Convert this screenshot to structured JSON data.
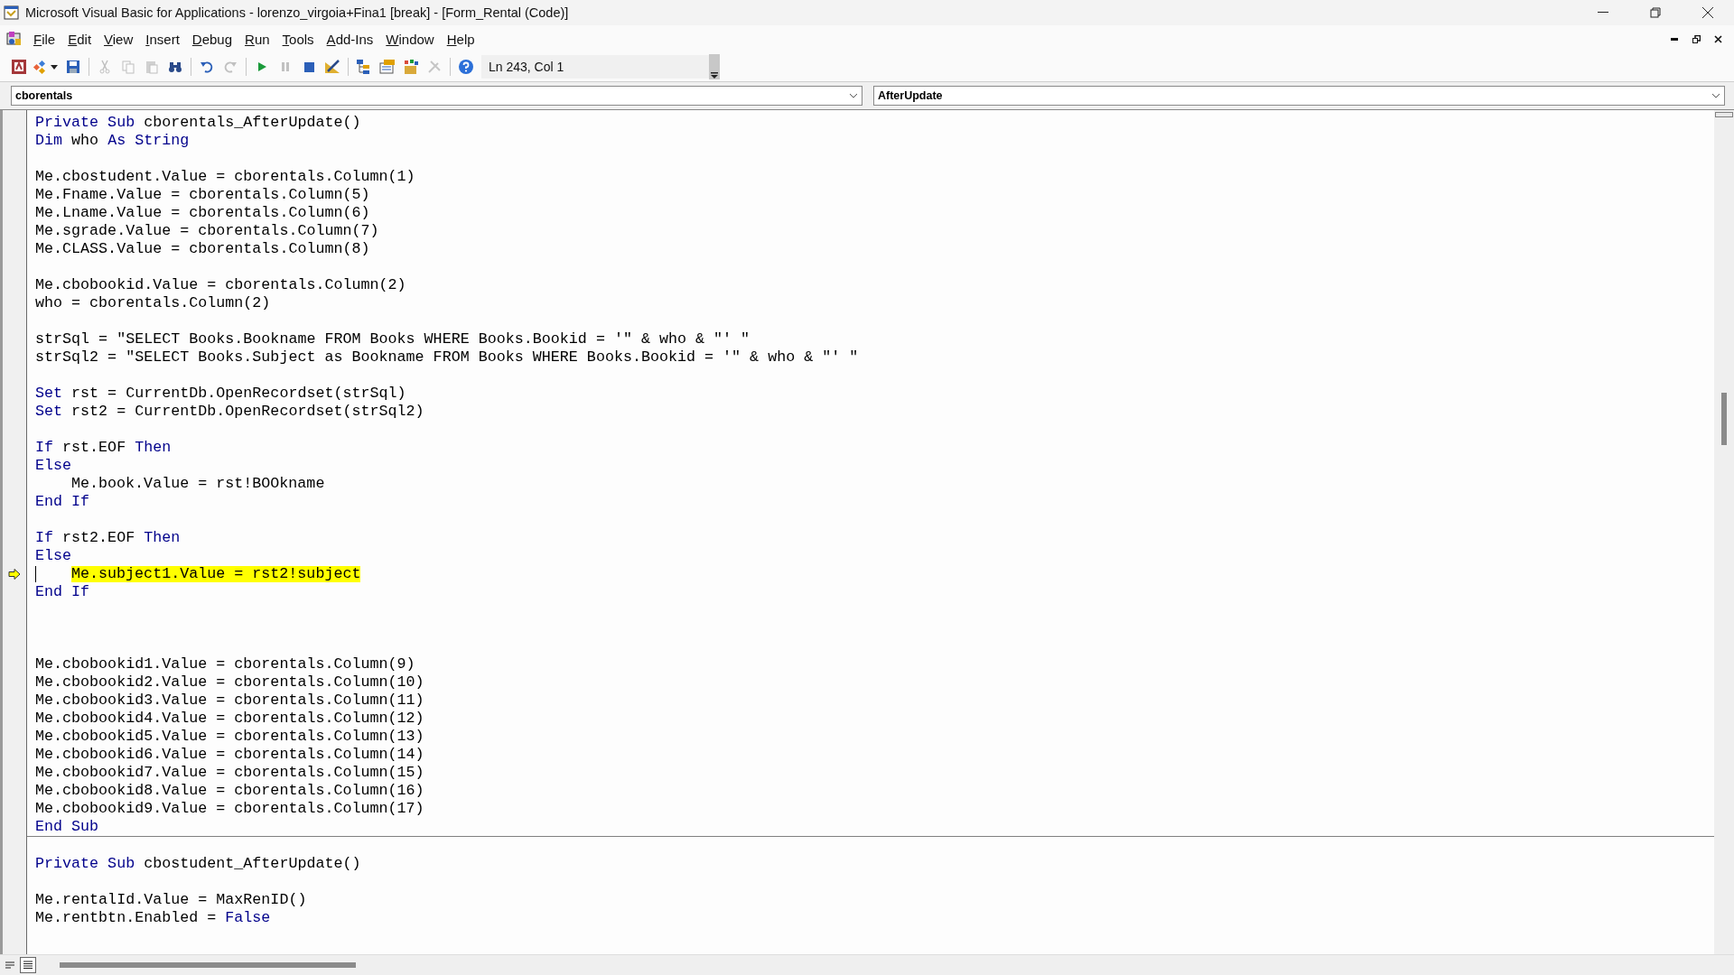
{
  "window": {
    "title": "Microsoft Visual Basic for Applications - lorenzo_virgoia+Fina1 [break] - [Form_Rental (Code)]"
  },
  "menu": [
    {
      "label": "File"
    },
    {
      "label": "Edit"
    },
    {
      "label": "View"
    },
    {
      "label": "Insert"
    },
    {
      "label": "Debug"
    },
    {
      "label": "Run"
    },
    {
      "label": "Tools"
    },
    {
      "label": "Add-Ins"
    },
    {
      "label": "Window"
    },
    {
      "label": "Help"
    }
  ],
  "toolbar": [
    {
      "kind": "access",
      "disabled": false
    },
    {
      "kind": "insert",
      "disabled": false
    },
    {
      "kind": "save",
      "disabled": false
    },
    {
      "kind": "sep"
    },
    {
      "kind": "cut",
      "disabled": true
    },
    {
      "kind": "copy",
      "disabled": true
    },
    {
      "kind": "paste",
      "disabled": true
    },
    {
      "kind": "find",
      "disabled": false
    },
    {
      "kind": "sep"
    },
    {
      "kind": "undo",
      "disabled": false
    },
    {
      "kind": "redo",
      "disabled": true
    },
    {
      "kind": "sep"
    },
    {
      "kind": "run",
      "disabled": false
    },
    {
      "kind": "pause",
      "disabled": true
    },
    {
      "kind": "reset",
      "disabled": false
    },
    {
      "kind": "design",
      "disabled": false
    },
    {
      "kind": "sep"
    },
    {
      "kind": "project",
      "disabled": false
    },
    {
      "kind": "properties",
      "disabled": false
    },
    {
      "kind": "browser",
      "disabled": false
    },
    {
      "kind": "toolbox",
      "disabled": true
    },
    {
      "kind": "sep"
    },
    {
      "kind": "help",
      "disabled": false
    }
  ],
  "cursor_position": "Ln 243, Col 1",
  "object_box": {
    "value": "cborentals"
  },
  "procedure_box": {
    "value": "AfterUpdate"
  },
  "procedures": [
    {
      "lines": [
        {
          "kind": "code",
          "segments": [
            {
              "kind": "keyword",
              "text": "Private Sub"
            },
            {
              "kind": "plain",
              "text": " cborentals_AfterUpdate()"
            }
          ]
        },
        {
          "kind": "code",
          "segments": [
            {
              "kind": "keyword",
              "text": "Dim"
            },
            {
              "kind": "plain",
              "text": " who "
            },
            {
              "kind": "keyword",
              "text": "As String"
            }
          ]
        },
        {
          "kind": "blank"
        },
        {
          "kind": "code",
          "segments": [
            {
              "kind": "plain",
              "text": "Me.cbostudent.Value = cborentals.Column(1)"
            }
          ]
        },
        {
          "kind": "code",
          "segments": [
            {
              "kind": "plain",
              "text": "Me.Fname.Value = cborentals.Column(5)"
            }
          ]
        },
        {
          "kind": "code",
          "segments": [
            {
              "kind": "plain",
              "text": "Me.Lname.Value = cborentals.Column(6)"
            }
          ]
        },
        {
          "kind": "code",
          "segments": [
            {
              "kind": "plain",
              "text": "Me.sgrade.Value = cborentals.Column(7)"
            }
          ]
        },
        {
          "kind": "code",
          "segments": [
            {
              "kind": "plain",
              "text": "Me.CLASS.Value = cborentals.Column(8)"
            }
          ]
        },
        {
          "kind": "blank"
        },
        {
          "kind": "code",
          "segments": [
            {
              "kind": "plain",
              "text": "Me.cbobookid.Value = cborentals.Column(2)"
            }
          ]
        },
        {
          "kind": "code",
          "segments": [
            {
              "kind": "plain",
              "text": "who = cborentals.Column(2)"
            }
          ]
        },
        {
          "kind": "blank"
        },
        {
          "kind": "code",
          "segments": [
            {
              "kind": "plain",
              "text": "strSql = \"SELECT Books.Bookname FROM Books WHERE Books.Bookid = '\" & who & \"' \""
            }
          ]
        },
        {
          "kind": "code",
          "segments": [
            {
              "kind": "plain",
              "text": "strSql2 = \"SELECT Books.Subject as Bookname FROM Books WHERE Books.Bookid = '\" & who & \"' \""
            }
          ]
        },
        {
          "kind": "blank"
        },
        {
          "kind": "code",
          "segments": [
            {
              "kind": "keyword",
              "text": "Set"
            },
            {
              "kind": "plain",
              "text": " rst = CurrentDb.OpenRecordset(strSql)"
            }
          ]
        },
        {
          "kind": "code",
          "segments": [
            {
              "kind": "keyword",
              "text": "Set"
            },
            {
              "kind": "plain",
              "text": " rst2 = CurrentDb.OpenRecordset(strSql2)"
            }
          ]
        },
        {
          "kind": "blank"
        },
        {
          "kind": "code",
          "segments": [
            {
              "kind": "keyword",
              "text": "If"
            },
            {
              "kind": "plain",
              "text": " rst.EOF "
            },
            {
              "kind": "keyword",
              "text": "Then"
            }
          ]
        },
        {
          "kind": "code",
          "segments": [
            {
              "kind": "keyword",
              "text": "Else"
            }
          ]
        },
        {
          "kind": "code",
          "indented": true,
          "segments": [
            {
              "kind": "plain",
              "text": "Me.book.Value = rst!BOOkname"
            }
          ]
        },
        {
          "kind": "code",
          "segments": [
            {
              "kind": "keyword",
              "text": "End If"
            }
          ]
        },
        {
          "kind": "blank"
        },
        {
          "kind": "code",
          "segments": [
            {
              "kind": "keyword",
              "text": "If"
            },
            {
              "kind": "plain",
              "text": " rst2.EOF "
            },
            {
              "kind": "keyword",
              "text": "Then"
            }
          ]
        },
        {
          "kind": "code",
          "segments": [
            {
              "kind": "keyword",
              "text": "Else"
            }
          ]
        },
        {
          "kind": "code",
          "indented": true,
          "current": true,
          "segments": [
            {
              "kind": "plain",
              "text": "Me.subject1.Value = rst2!subject"
            }
          ]
        },
        {
          "kind": "code",
          "segments": [
            {
              "kind": "keyword",
              "text": "End If"
            }
          ]
        },
        {
          "kind": "blank"
        },
        {
          "kind": "blank"
        },
        {
          "kind": "blank"
        },
        {
          "kind": "code",
          "segments": [
            {
              "kind": "plain",
              "text": "Me.cbobookid1.Value = cborentals.Column(9)"
            }
          ]
        },
        {
          "kind": "code",
          "segments": [
            {
              "kind": "plain",
              "text": "Me.cbobookid2.Value = cborentals.Column(10)"
            }
          ]
        },
        {
          "kind": "code",
          "segments": [
            {
              "kind": "plain",
              "text": "Me.cbobookid3.Value = cborentals.Column(11)"
            }
          ]
        },
        {
          "kind": "code",
          "segments": [
            {
              "kind": "plain",
              "text": "Me.cbobookid4.Value = cborentals.Column(12)"
            }
          ]
        },
        {
          "kind": "code",
          "segments": [
            {
              "kind": "plain",
              "text": "Me.cbobookid5.Value = cborentals.Column(13)"
            }
          ]
        },
        {
          "kind": "code",
          "segments": [
            {
              "kind": "plain",
              "text": "Me.cbobookid6.Value = cborentals.Column(14)"
            }
          ]
        },
        {
          "kind": "code",
          "segments": [
            {
              "kind": "plain",
              "text": "Me.cbobookid7.Value = cborentals.Column(15)"
            }
          ]
        },
        {
          "kind": "code",
          "segments": [
            {
              "kind": "plain",
              "text": "Me.cbobookid8.Value = cborentals.Column(16)"
            }
          ]
        },
        {
          "kind": "code",
          "segments": [
            {
              "kind": "plain",
              "text": "Me.cbobookid9.Value = cborentals.Column(17)"
            }
          ]
        },
        {
          "kind": "code",
          "segments": [
            {
              "kind": "keyword",
              "text": "End Sub"
            }
          ]
        }
      ]
    },
    {
      "lines": [
        {
          "kind": "blank"
        },
        {
          "kind": "code",
          "segments": [
            {
              "kind": "keyword",
              "text": "Private Sub"
            },
            {
              "kind": "plain",
              "text": " cbostudent_AfterUpdate()"
            }
          ]
        },
        {
          "kind": "blank"
        },
        {
          "kind": "code",
          "segments": [
            {
              "kind": "plain",
              "text": "Me.rentalId.Value = MaxRenID()"
            }
          ]
        },
        {
          "kind": "code",
          "segments": [
            {
              "kind": "plain",
              "text": "Me.rentbtn.Enabled = "
            },
            {
              "kind": "keyword",
              "text": "False"
            }
          ]
        }
      ]
    }
  ]
}
